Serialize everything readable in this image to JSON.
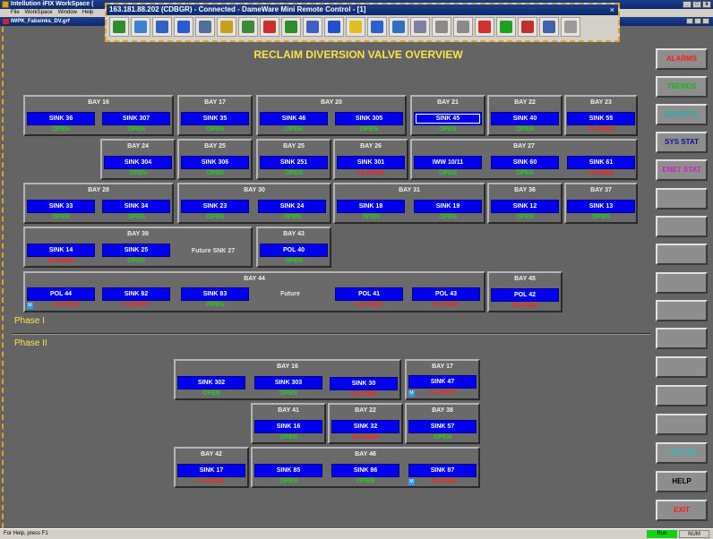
{
  "window": {
    "title": "Intellution iFIX WorkSpace (",
    "menu": [
      "File",
      "WorkSpace",
      "Window",
      "Help"
    ],
    "document_title": "IWPK_Fabsinks_DV.grf"
  },
  "remote": {
    "title": "163.181.88.202 (CDBGR) - Connected - DameWare Mini Remote Control - [1]",
    "close": "×",
    "tool_colors": [
      "#2e8b2e",
      "#3f7fd0",
      "#3060c0",
      "#2a5bd0",
      "#4f6f9f",
      "#c8a020",
      "#3a8a3a",
      "#c83030",
      "#2d8d2d",
      "#4060c0",
      "#2050d0",
      "#e0c020",
      "#2a60d0",
      "#3070c0",
      "#8080a0",
      "#8a8a8a",
      "#8a8a8a",
      "#d03030",
      "#20a020",
      "#c03030",
      "#4060b0",
      "#9a9a9a"
    ]
  },
  "screen": {
    "title": "RECLAIM DIVERSION VALVE OVERVIEW"
  },
  "phases": {
    "phase1": "Phase I",
    "phase2": "Phase II"
  },
  "bays": {
    "b16": {
      "title": "BAY 16"
    },
    "b17": {
      "title": "BAY 17"
    },
    "b20": {
      "title": "BAY 20"
    },
    "b21": {
      "title": "BAY 21"
    },
    "b22": {
      "title": "BAY 22"
    },
    "b23": {
      "title": "BAY 23"
    },
    "b24": {
      "title": "BAY 24"
    },
    "b25a": {
      "title": "BAY 25"
    },
    "b25b": {
      "title": "BAY 25"
    },
    "b26": {
      "title": "BAY 26"
    },
    "b27": {
      "title": "BAY 27"
    },
    "b28": {
      "title": "BAY 28"
    },
    "b30": {
      "title": "BAY 30"
    },
    "b31": {
      "title": "BAY 31"
    },
    "b36": {
      "title": "BAY 36"
    },
    "b37": {
      "title": "BAY 37"
    },
    "b39": {
      "title": "BAY 39"
    },
    "b43": {
      "title": "BAY 43"
    },
    "b44": {
      "title": "BAY 44"
    },
    "b45": {
      "title": "BAY 45"
    },
    "p2b16": {
      "title": "BAY 16"
    },
    "p2b17": {
      "title": "BAY 17"
    },
    "p2b41": {
      "title": "BAY 41"
    },
    "p2b22": {
      "title": "BAY 22"
    },
    "p2b38": {
      "title": "BAY 38"
    },
    "p2b42": {
      "title": "BAY 42"
    },
    "p2b46": {
      "title": "BAY 46"
    }
  },
  "sinks": {
    "s36": {
      "label": "SINK 36",
      "state": "OPEN"
    },
    "s307": {
      "label": "SINK 307",
      "state": "OPEN"
    },
    "s35": {
      "label": "SINK 35",
      "state": "OPEN"
    },
    "s46": {
      "label": "SINK 46",
      "state": "OPEN"
    },
    "s305": {
      "label": "SINK 305",
      "state": "OPEN"
    },
    "s45": {
      "label": "SINK 45",
      "state": "OPEN"
    },
    "s40": {
      "label": "SINK 40",
      "state": "OPEN"
    },
    "s55": {
      "label": "SINK 55",
      "state": "CLOSED"
    },
    "s304": {
      "label": "SINK 304",
      "state": "OPEN"
    },
    "s306": {
      "label": "SINK 306",
      "state": "OPEN"
    },
    "s251": {
      "label": "SINK 251",
      "state": "OPEN"
    },
    "s301": {
      "label": "SINK 301",
      "state": "CLOSED"
    },
    "iww": {
      "label": "IWW 10/11",
      "state": "OPEN"
    },
    "s60": {
      "label": "SINK 60",
      "state": "OPEN"
    },
    "s61": {
      "label": "SINK 61",
      "state": "CLOSED"
    },
    "s33": {
      "label": "SINK 33",
      "state": "OPEN"
    },
    "s34": {
      "label": "SINK 34",
      "state": "OPEN"
    },
    "s23": {
      "label": "SINK 23",
      "state": "OPEN"
    },
    "s24": {
      "label": "SINK 24",
      "state": "OPEN"
    },
    "s18": {
      "label": "SINK 18",
      "state": "OPEN"
    },
    "s19": {
      "label": "SINK 19",
      "state": "OPEN"
    },
    "s12": {
      "label": "SINK 12",
      "state": "OPEN"
    },
    "s13": {
      "label": "SINK 13",
      "state": "OPEN"
    },
    "s14": {
      "label": "SINK 14",
      "state": "CLOSED"
    },
    "s25": {
      "label": "SINK 25",
      "state": "OPEN"
    },
    "pol40": {
      "label": "POL 40",
      "state": "OPEN"
    },
    "pol44": {
      "label": "POL 44",
      "state": "CLOSED"
    },
    "s82": {
      "label": "SINK 82",
      "state": "CLOSED"
    },
    "s83": {
      "label": "SINK 83",
      "state": "OPEN"
    },
    "pol41": {
      "label": "POL 41",
      "state": "CLOSED"
    },
    "pol43": {
      "label": "POL 43",
      "state": "CLOSED"
    },
    "pol42": {
      "label": "POL 42",
      "state": "CLOSED"
    },
    "s302": {
      "label": "SINK 302",
      "state": "OPEN"
    },
    "s303": {
      "label": "SINK 303",
      "state": "OPEN"
    },
    "s30": {
      "label": "SINK 30",
      "state": "CLOSED"
    },
    "s47": {
      "label": "SINK 47",
      "state": "CLOSED"
    },
    "s16": {
      "label": "SINK 16",
      "state": "OPEN"
    },
    "s32": {
      "label": "SINK 32",
      "state": "CLOSED"
    },
    "s57": {
      "label": "SINK 57",
      "state": "OPEN"
    },
    "s17": {
      "label": "SINK 17",
      "state": "CLOSED"
    },
    "s85": {
      "label": "SINK 85",
      "state": "OPEN"
    },
    "s86": {
      "label": "SINK 86",
      "state": "OPEN"
    },
    "s87": {
      "label": "SINK 87",
      "state": "CLOSED"
    }
  },
  "futures": {
    "snk27": "Future SNK 27",
    "f44": "Future"
  },
  "markers": {
    "m": "M"
  },
  "nav": {
    "alarms": {
      "label": "ALARMS",
      "color": "#ff1a1a"
    },
    "trends": {
      "label": "TRENDS",
      "color": "#14b814"
    },
    "reports": {
      "label": "REPORTS",
      "color": "#22b0b0"
    },
    "sysstat": {
      "label": "SYS STAT",
      "color": "#101090"
    },
    "enetstat": {
      "label": "ENET STAT",
      "color": "#d020c0"
    },
    "login": {
      "label": "LOG ON",
      "color": "#22c0c0"
    },
    "help": {
      "label": "HELP",
      "color": "#000000"
    },
    "exit": {
      "label": "EXIT",
      "color": "#ff1a1a"
    }
  },
  "status": {
    "help": "For Help, press F1",
    "run": "Run",
    "num": "NUM"
  }
}
